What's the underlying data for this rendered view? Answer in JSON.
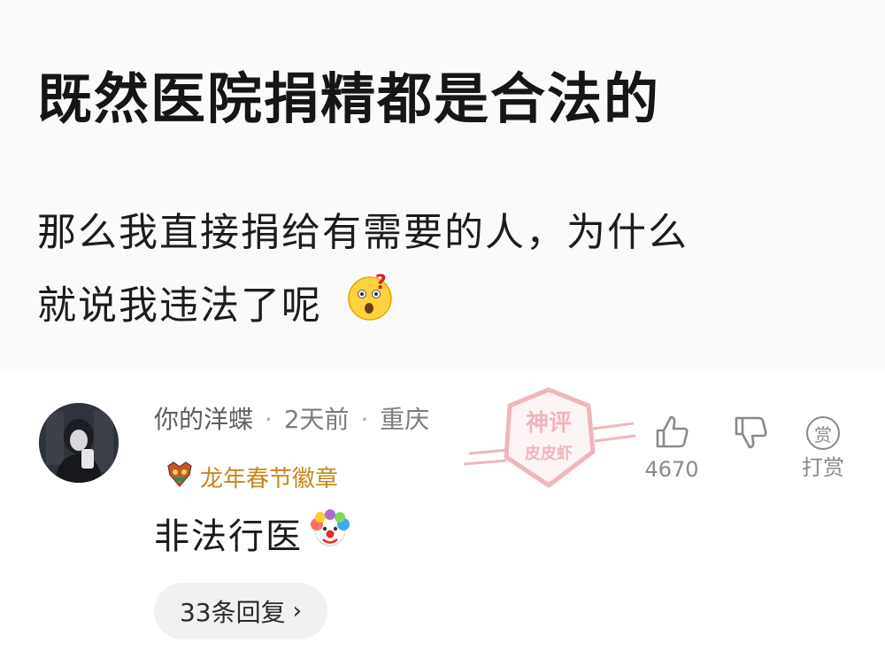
{
  "post": {
    "title": "既然医院捐精都是合法的",
    "body_line1": "那么我直接捐给有需要的人，为什么",
    "body_line2": "就说我违法了呢",
    "body_emoji": "confused-face-emoji"
  },
  "comment": {
    "username": "你的洋蝶",
    "time": "2天前",
    "location": "重庆",
    "badge_label": "龙年春节徽章",
    "text": "非法行医",
    "text_emoji": "clown-face-emoji",
    "replies_label": "33条回复"
  },
  "actions": {
    "like_count": "4670",
    "reward_label": "打赏",
    "reward_icon_char": "赏"
  },
  "watermark": {
    "line1": "神评",
    "line2": "皮皮虾"
  },
  "colors": {
    "post_bg": "#fafafa",
    "badge_text": "#c9861a",
    "watermark": "#e57b84"
  }
}
